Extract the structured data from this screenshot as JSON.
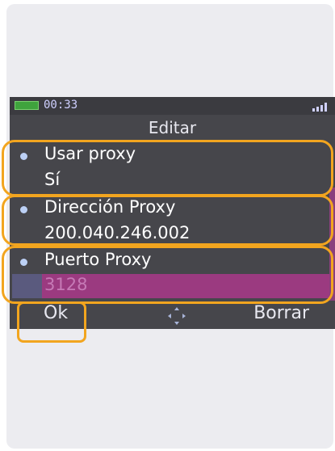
{
  "status_bar": {
    "time": "00:33",
    "battery_icon": "battery-icon",
    "signal_icon": "signal-icon"
  },
  "screen": {
    "title": "Editar"
  },
  "settings": [
    {
      "label": "Usar proxy",
      "value": "Sí"
    },
    {
      "label": "Dirección Proxy",
      "value": "200.040.246.002"
    },
    {
      "label": "Puerto Proxy",
      "value": "3128"
    }
  ],
  "softkeys": {
    "left": "Ok",
    "right": "Borrar",
    "center_icon": "nav-pad-icon"
  },
  "colors": {
    "highlight": "#f2a51f",
    "field_bg": "#9b3a80",
    "screen_bg": "#46464b"
  }
}
